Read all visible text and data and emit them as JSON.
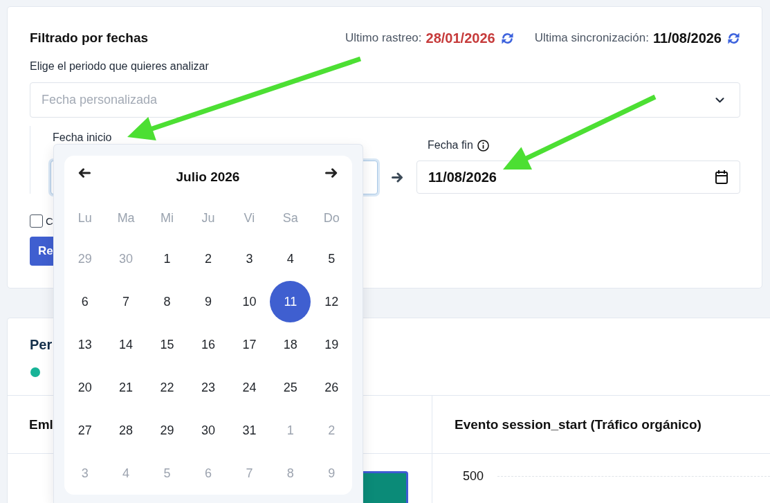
{
  "filter_card": {
    "title": "Filtrado por fechas",
    "last_crawl": {
      "label": "Ultimo rastreo:",
      "date": "28/01/2026",
      "warning": true
    },
    "last_sync": {
      "label": "Ultima sincronización:",
      "date": "11/08/2026",
      "warning": false
    },
    "subtitle": "Elige el periodo que quieres analizar",
    "period_select": {
      "placeholder": "Fecha personalizada"
    },
    "start_date": {
      "label": "Fecha inicio",
      "focused": true
    },
    "end_date": {
      "label": "Fecha fin",
      "value": "11/08/2026",
      "focused": false
    },
    "checkbox": {
      "label": "C",
      "checked": false
    },
    "button": {
      "label": "Re"
    }
  },
  "calendar": {
    "month": "Julio 2026",
    "weekdays": [
      "Lu",
      "Ma",
      "Mi",
      "Ju",
      "Vi",
      "Sa",
      "Do"
    ],
    "days": [
      {
        "day": "29",
        "outside": true,
        "selected": false
      },
      {
        "day": "30",
        "outside": true,
        "selected": false
      },
      {
        "day": "1",
        "outside": false,
        "selected": false
      },
      {
        "day": "2",
        "outside": false,
        "selected": false
      },
      {
        "day": "3",
        "outside": false,
        "selected": false
      },
      {
        "day": "4",
        "outside": false,
        "selected": false
      },
      {
        "day": "5",
        "outside": false,
        "selected": false
      },
      {
        "day": "6",
        "outside": false,
        "selected": false
      },
      {
        "day": "7",
        "outside": false,
        "selected": false
      },
      {
        "day": "8",
        "outside": false,
        "selected": false
      },
      {
        "day": "9",
        "outside": false,
        "selected": false
      },
      {
        "day": "10",
        "outside": false,
        "selected": false
      },
      {
        "day": "11",
        "outside": false,
        "selected": true
      },
      {
        "day": "12",
        "outside": false,
        "selected": false
      },
      {
        "day": "13",
        "outside": false,
        "selected": false
      },
      {
        "day": "14",
        "outside": false,
        "selected": false
      },
      {
        "day": "15",
        "outside": false,
        "selected": false
      },
      {
        "day": "16",
        "outside": false,
        "selected": false
      },
      {
        "day": "17",
        "outside": false,
        "selected": false
      },
      {
        "day": "18",
        "outside": false,
        "selected": false
      },
      {
        "day": "19",
        "outside": false,
        "selected": false
      },
      {
        "day": "20",
        "outside": false,
        "selected": false
      },
      {
        "day": "21",
        "outside": false,
        "selected": false
      },
      {
        "day": "22",
        "outside": false,
        "selected": false
      },
      {
        "day": "23",
        "outside": false,
        "selected": false
      },
      {
        "day": "24",
        "outside": false,
        "selected": false
      },
      {
        "day": "25",
        "outside": false,
        "selected": false
      },
      {
        "day": "26",
        "outside": false,
        "selected": false
      },
      {
        "day": "27",
        "outside": false,
        "selected": false
      },
      {
        "day": "28",
        "outside": false,
        "selected": false
      },
      {
        "day": "29",
        "outside": false,
        "selected": false
      },
      {
        "day": "30",
        "outside": false,
        "selected": false
      },
      {
        "day": "31",
        "outside": false,
        "selected": false
      },
      {
        "day": "1",
        "outside": true,
        "selected": false
      },
      {
        "day": "2",
        "outside": true,
        "selected": false
      },
      {
        "day": "3",
        "outside": true,
        "selected": false
      },
      {
        "day": "4",
        "outside": true,
        "selected": false
      },
      {
        "day": "5",
        "outside": true,
        "selected": false
      },
      {
        "day": "6",
        "outside": true,
        "selected": false
      },
      {
        "day": "7",
        "outside": true,
        "selected": false
      },
      {
        "day": "8",
        "outside": true,
        "selected": false
      },
      {
        "day": "9",
        "outside": true,
        "selected": false
      }
    ]
  },
  "results_card": {
    "title": "Per",
    "legend": [
      {
        "color": "#17b397"
      }
    ],
    "columns": [
      {
        "header": "Eml",
        "kind": "bars"
      },
      {
        "header": "Evento session_start (Tráfico orgánico)",
        "kind": "ticks",
        "y_ticks": [
          "500"
        ]
      }
    ]
  },
  "annotations": [
    {
      "kind": "arrow"
    },
    {
      "kind": "arrow"
    }
  ]
}
